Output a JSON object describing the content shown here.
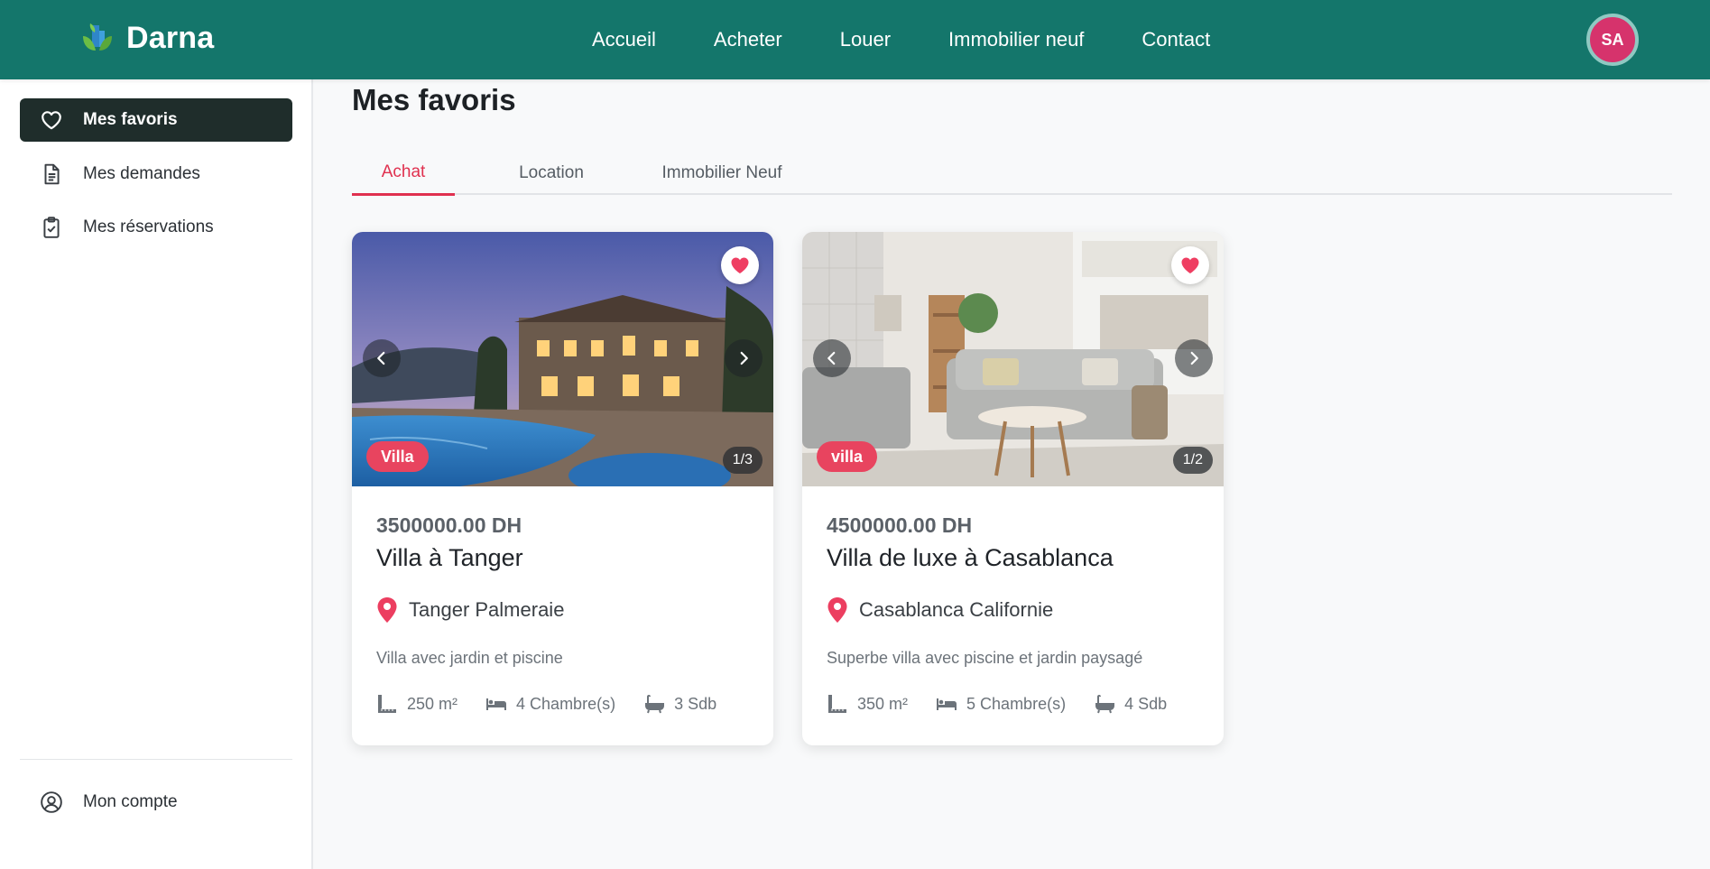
{
  "app": {
    "brand_name": "Darna",
    "avatar_initials": "SA"
  },
  "nav": {
    "items": [
      "Accueil",
      "Acheter",
      "Louer",
      "Immobilier neuf",
      "Contact"
    ]
  },
  "sidebar": {
    "items": [
      {
        "label": "Mes favoris",
        "icon": "heart-icon",
        "active": true
      },
      {
        "label": "Mes demandes",
        "icon": "document-icon",
        "active": false
      },
      {
        "label": "Mes réservations",
        "icon": "clipboard-check-icon",
        "active": false
      }
    ],
    "account_label": "Mon compte"
  },
  "main": {
    "title": "Mes favoris",
    "tabs": [
      {
        "label": "Achat",
        "active": true
      },
      {
        "label": "Location",
        "active": false
      },
      {
        "label": "Immobilier Neuf",
        "active": false
      }
    ]
  },
  "listings": [
    {
      "type": "Villa",
      "photo_counter": "1/3",
      "price": "3500000.00 DH",
      "title": "Villa à Tanger",
      "location": "Tanger Palmeraie",
      "description": "Villa avec jardin et piscine",
      "area": "250 m²",
      "rooms": "4 Chambre(s)",
      "baths": "3 Sdb",
      "favorited": true
    },
    {
      "type": "villa",
      "photo_counter": "1/2",
      "price": "4500000.00 DH",
      "title": "Villa de luxe à Casablanca",
      "location": "Casablanca Californie",
      "description": "Superbe villa avec piscine et jardin paysagé",
      "area": "350 m²",
      "rooms": "5 Chambre(s)",
      "baths": "4 Sdb",
      "favorited": true
    }
  ],
  "colors": {
    "header": "#14766b",
    "accent": "#e0314f",
    "sidebar_active": "#1f2d2b",
    "avatar": "#d6336c"
  }
}
